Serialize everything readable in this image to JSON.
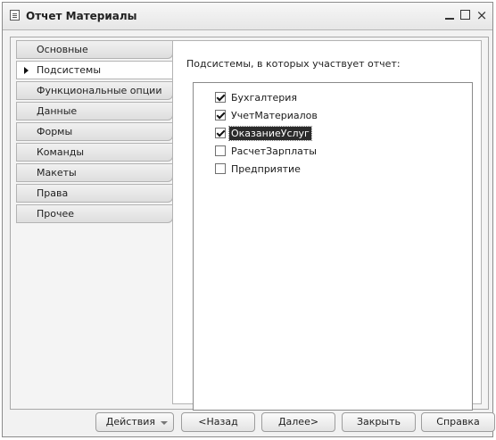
{
  "window": {
    "title": "Отчет Материалы",
    "controls": {
      "minimize": "_",
      "maximize": "□",
      "close": "×"
    }
  },
  "tabs": [
    {
      "label": "Основные",
      "active": false
    },
    {
      "label": "Подсистемы",
      "active": true
    },
    {
      "label": "Функциональные опции",
      "active": false
    },
    {
      "label": "Данные",
      "active": false
    },
    {
      "label": "Формы",
      "active": false
    },
    {
      "label": "Команды",
      "active": false
    },
    {
      "label": "Макеты",
      "active": false
    },
    {
      "label": "Права",
      "active": false
    },
    {
      "label": "Прочее",
      "active": false
    }
  ],
  "panel": {
    "label": "Подсистемы, в которых участвует отчет:",
    "items": [
      {
        "label": "Бухгалтерия",
        "checked": true,
        "selected": false
      },
      {
        "label": "УчетМатериалов",
        "checked": true,
        "selected": false
      },
      {
        "label": "ОказаниеУслуг",
        "checked": true,
        "selected": true
      },
      {
        "label": "РасчетЗарплаты",
        "checked": false,
        "selected": false
      },
      {
        "label": "Предприятие",
        "checked": false,
        "selected": false
      }
    ]
  },
  "buttons": {
    "actions": "Действия",
    "back": "<Назад",
    "next": "Далее>",
    "close": "Закрыть",
    "help": "Справка"
  }
}
